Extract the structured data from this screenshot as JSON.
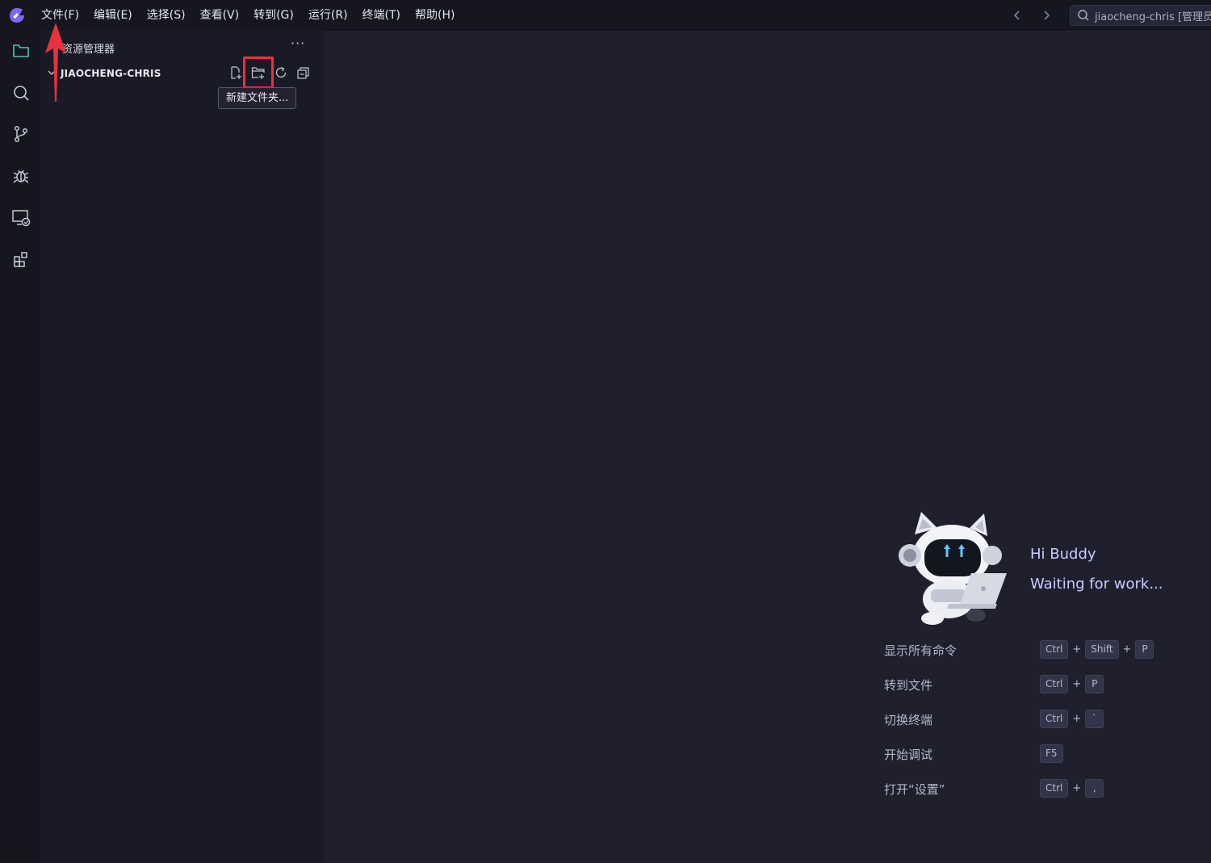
{
  "menu": {
    "items": [
      "文件(F)",
      "编辑(E)",
      "选择(S)",
      "查看(V)",
      "转到(G)",
      "运行(R)",
      "终端(T)",
      "帮助(H)"
    ]
  },
  "search": {
    "text": "jiaocheng-chris [管理员]"
  },
  "sidebar": {
    "title": "资源管理器",
    "more": "···",
    "folder_name": "JIAOCHENG-CHRIS",
    "tooltip": "新建文件夹..."
  },
  "welcome": {
    "greeting": "Hi Buddy",
    "status": "Waiting for work...",
    "shortcuts": [
      {
        "label": "显示所有命令",
        "keys": [
          "Ctrl",
          "Shift",
          "P"
        ]
      },
      {
        "label": "转到文件",
        "keys": [
          "Ctrl",
          "P"
        ]
      },
      {
        "label": "切换终端",
        "keys": [
          "Ctrl",
          "`"
        ]
      },
      {
        "label": "开始调试",
        "keys": [
          "F5"
        ]
      },
      {
        "label": "打开“设置”",
        "keys": [
          "Ctrl",
          ","
        ]
      }
    ]
  },
  "colors": {
    "accent": "#4ec9b0",
    "annotation": "#e8323d",
    "background": "#1f1f2e",
    "sidebar": "#1a1a27",
    "titlebar": "#161621"
  },
  "icons": {
    "activity": [
      "explorer-icon",
      "search-icon",
      "source-control-icon",
      "debug-icon",
      "remote-explorer-icon",
      "extensions-icon"
    ],
    "folder_actions": [
      "new-file-icon",
      "new-folder-icon",
      "refresh-icon",
      "collapse-all-icon"
    ]
  }
}
